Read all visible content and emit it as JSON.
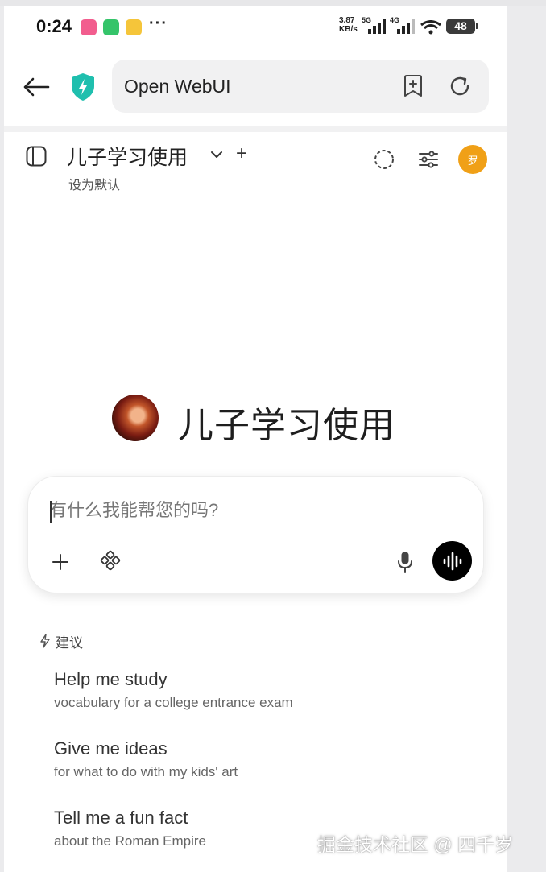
{
  "status_bar": {
    "time": "0:24",
    "more": "···",
    "net_speed_value": "3.87",
    "net_speed_unit": "KB/s",
    "sim1_label": "5G",
    "sim2_label": "4G",
    "battery": "48"
  },
  "browser": {
    "url_title": "Open WebUI"
  },
  "app_header": {
    "model_name": "儿子学习使用",
    "add_label": "+",
    "set_default": "设为默认",
    "user_initial": "罗"
  },
  "hero": {
    "title": "儿子学习使用"
  },
  "composer": {
    "placeholder": "有什么我能帮您的吗?",
    "value": ""
  },
  "suggestions": {
    "label": "建议",
    "items": [
      {
        "title": "Help me study",
        "subtitle": "vocabulary for a college entrance exam"
      },
      {
        "title": "Give me ideas",
        "subtitle": "for what to do with my kids' art"
      },
      {
        "title": "Tell me a fun fact",
        "subtitle": "about the Roman Empire"
      }
    ]
  },
  "watermark": "掘金技术社区 @ 四千岁",
  "colors": {
    "accent_shield": "#1fbfae",
    "user_avatar": "#f0a017",
    "voice_button": "#000000"
  }
}
